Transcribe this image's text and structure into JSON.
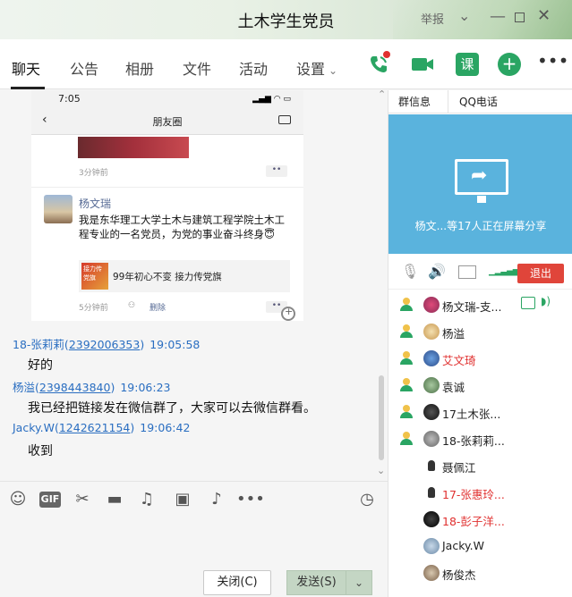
{
  "window": {
    "title": "土木学生党员",
    "report_label": "举报"
  },
  "tabs": [
    {
      "label": "聊天",
      "active": true
    },
    {
      "label": "公告"
    },
    {
      "label": "相册"
    },
    {
      "label": "文件"
    },
    {
      "label": "活动"
    },
    {
      "label": "设置"
    }
  ],
  "header_icons": {
    "phone": "phone-icon",
    "video": "video-icon",
    "class": "课",
    "add": "plus-icon",
    "more": "more-icon"
  },
  "screenshot": {
    "time": "7:05",
    "nav_title": "朋友圈",
    "ago1": "3分钟前",
    "dots": "••",
    "poster_name": "杨文瑞",
    "post_text": "我是东华理工大学土木与建筑工程学院土木工程专业的一名党员，为党的事业奋斗终身😇",
    "link_text": "99年初心不变 接力传党旗",
    "link_thumb_text": "接力传党旗",
    "ago2": "5分钟前",
    "delete_label": "删除"
  },
  "messages": [
    {
      "sender": "18-张莉莉",
      "qq": "2392006353",
      "time": "19:05:58",
      "text": "好的"
    },
    {
      "sender": "杨溢",
      "qq": "2398443840",
      "time": "19:06:23",
      "text": "我已经把链接发在微信群了，大家可以去微信群看。"
    },
    {
      "sender": "Jacky.W",
      "qq": "1242621154",
      "time": "19:06:42",
      "text": "收到"
    }
  ],
  "toolbar_icons": [
    "emoji-icon",
    "gif-icon",
    "scissors-icon",
    "folder-icon",
    "music-icon",
    "image-icon",
    "bell-icon",
    "more-icon",
    "history-icon"
  ],
  "gif_label": "GIF",
  "buttons": {
    "close": "关闭(C)",
    "send": "发送(S)"
  },
  "right_panel": {
    "tabs": [
      "群信息",
      "QQ电话"
    ],
    "share_text": "杨文...等17人正在屏幕分享",
    "exit_label": "退出"
  },
  "members": [
    {
      "name": "杨文瑞-支...",
      "red": false,
      "mic": true,
      "sharing": true
    },
    {
      "name": "杨溢",
      "red": false,
      "mic": true
    },
    {
      "name": "艾文琦",
      "red": true,
      "mic": true
    },
    {
      "name": "袁诚",
      "red": false,
      "mic": true
    },
    {
      "name": "17土木张...",
      "red": false,
      "mic": true
    },
    {
      "name": "18-张莉莉...",
      "red": false,
      "mic": true
    },
    {
      "name": "聂佩江",
      "red": false,
      "mic": false
    },
    {
      "name": "17-张惠玲...",
      "red": true,
      "mic": false
    },
    {
      "name": "18-彭子洋...",
      "red": true,
      "mic": false
    },
    {
      "name": "Jacky.W",
      "red": false,
      "mic": false
    },
    {
      "name": "杨俊杰",
      "red": false,
      "mic": false
    }
  ]
}
